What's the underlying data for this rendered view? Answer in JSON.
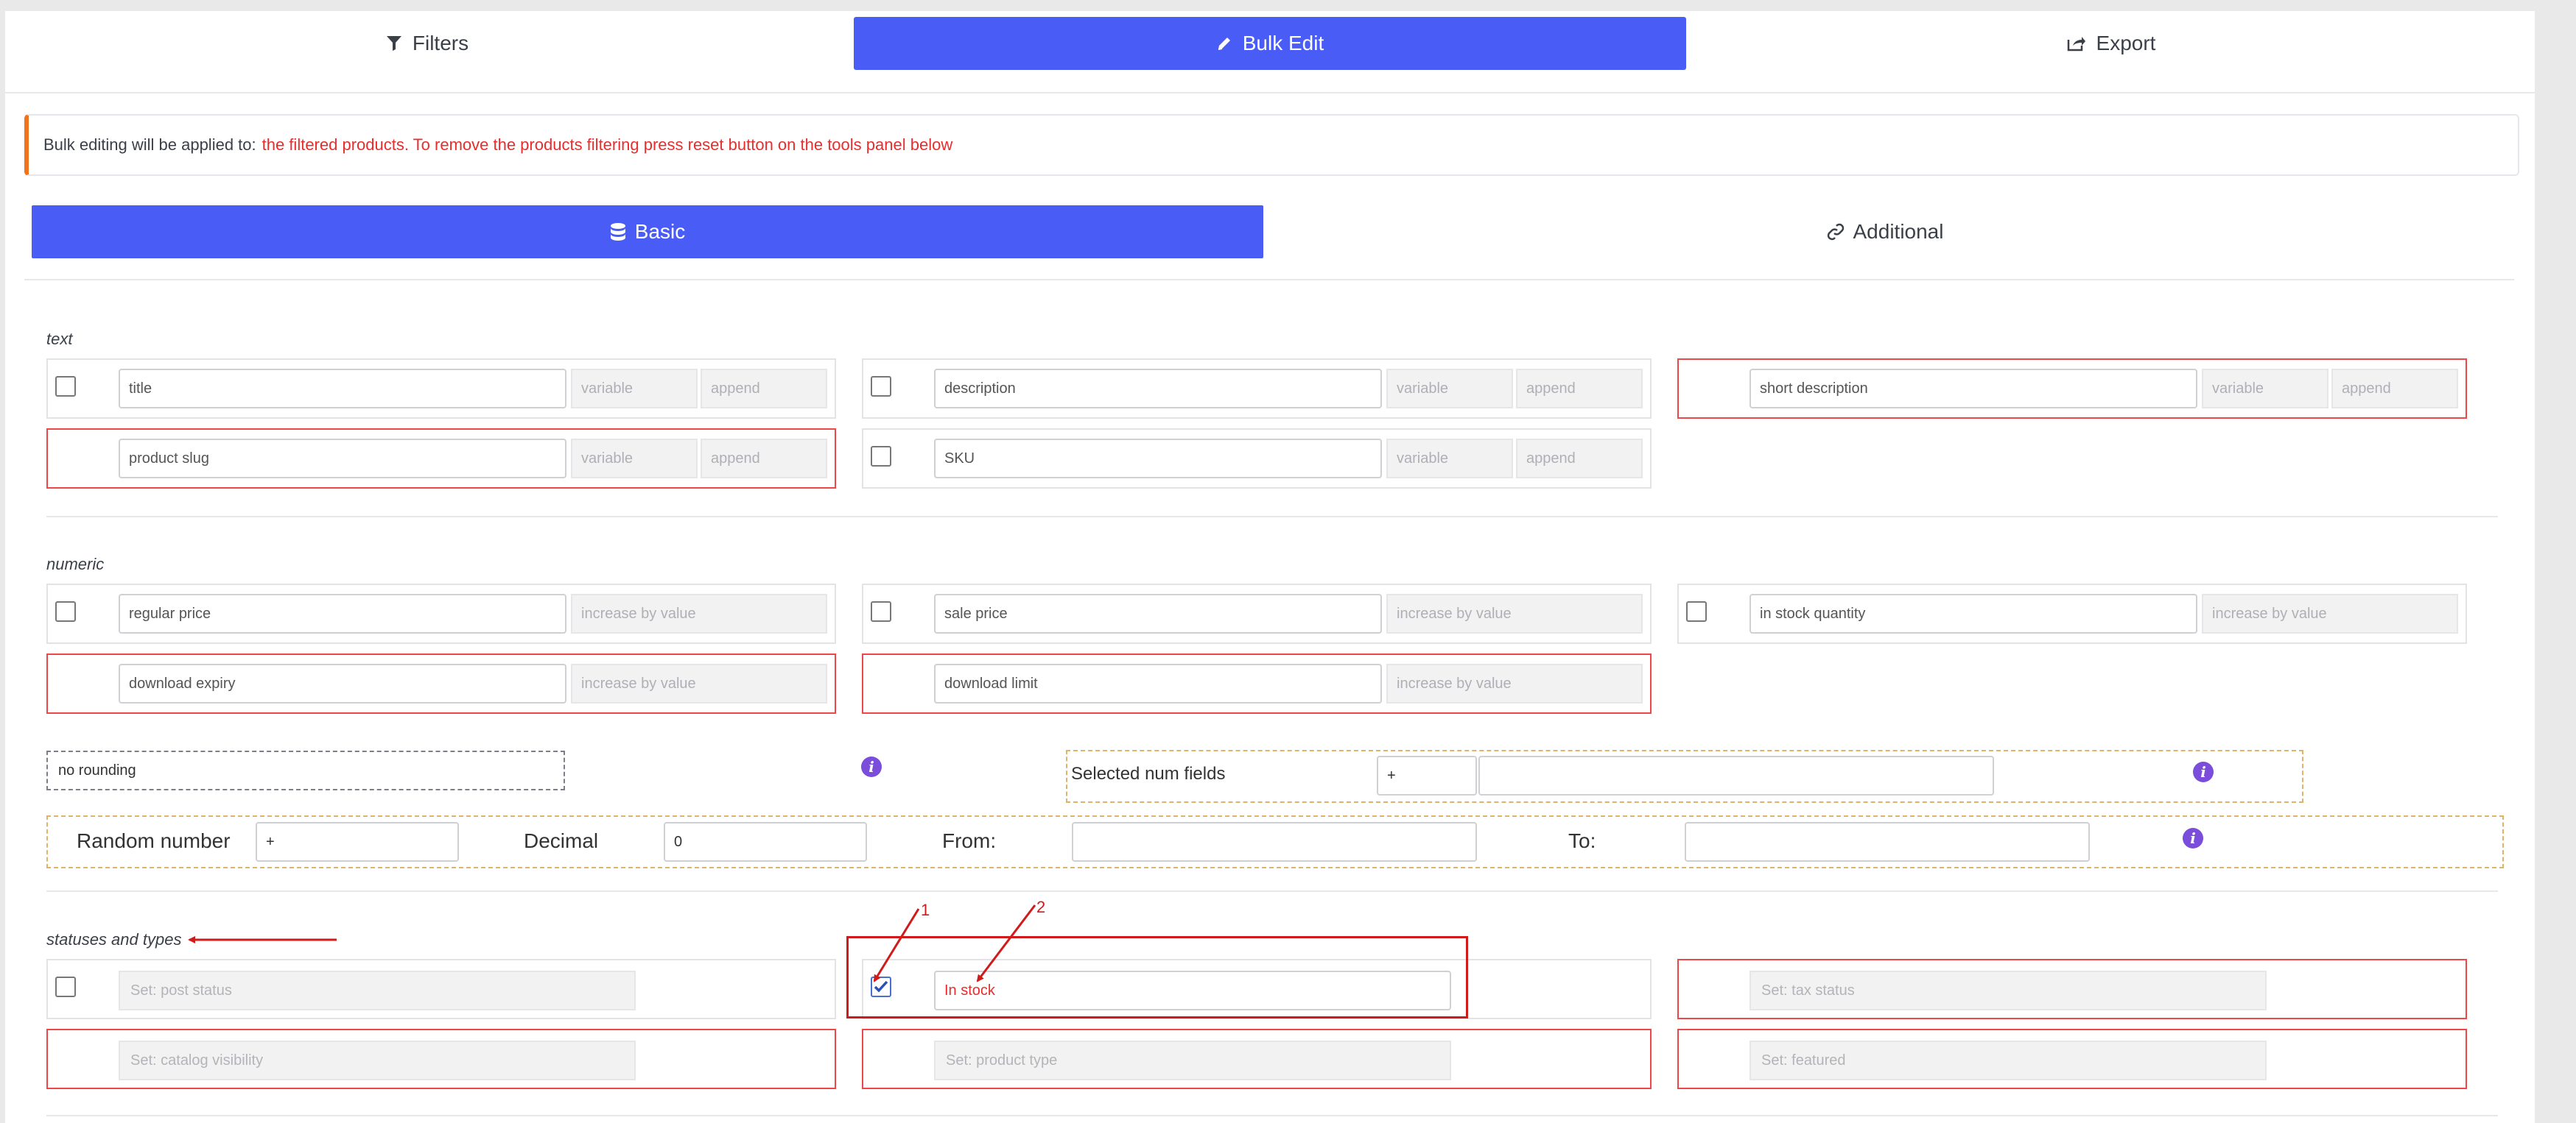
{
  "tabs": {
    "filters": "Filters",
    "bulk_edit": "Bulk Edit",
    "export": "Export"
  },
  "notice": {
    "prefix": "Bulk editing will be applied to:",
    "highlight": "the filtered products. To remove the products filtering press reset button on the tools panel below"
  },
  "subtabs": {
    "basic": "Basic",
    "additional": "Additional"
  },
  "sections": {
    "text": "text",
    "numeric": "numeric",
    "statuses": "statuses and types"
  },
  "text_fields": [
    {
      "label": "title",
      "s1": "variable",
      "s2": "append"
    },
    {
      "label": "description",
      "s1": "variable",
      "s2": "append"
    },
    {
      "label": "short description",
      "s1": "variable",
      "s2": "append"
    },
    {
      "label": "product slug",
      "s1": "variable",
      "s2": "append"
    },
    {
      "label": "SKU",
      "s1": "variable",
      "s2": "append"
    }
  ],
  "numeric_fields": [
    {
      "label": "regular price",
      "action": "increase by value"
    },
    {
      "label": "sale price",
      "action": "increase by value"
    },
    {
      "label": "in stock quantity",
      "action": "increase by value"
    },
    {
      "label": "download expiry",
      "action": "increase by value"
    },
    {
      "label": "download limit",
      "action": "increase by value"
    }
  ],
  "rounding": "no rounding",
  "selected_num": {
    "label": "Selected num fields",
    "operator": "+",
    "value": ""
  },
  "random": {
    "label": "Random number",
    "operator": "+",
    "decimal_label": "Decimal",
    "decimal_value": "0",
    "from_label": "From:",
    "from_value": "",
    "to_label": "To:",
    "to_value": ""
  },
  "status_fields": {
    "post_status": "Set: post status",
    "stock_status": "In stock",
    "tax_status": "Set: tax status",
    "catalog_visibility": "Set: catalog visibility",
    "product_type": "Set: product type",
    "featured": "Set: featured"
  },
  "annotations": {
    "one": "1",
    "two": "2"
  },
  "colors": {
    "accent": "#4a5cf6",
    "warning_border": "#f0731e",
    "highlight_text": "#e62e2e",
    "annotation": "#d01b1b",
    "info_icon": "#7b4ddb"
  },
  "icons": {
    "filters": "filter-icon",
    "bulk_edit": "pencil-icon",
    "export": "export-icon",
    "basic": "database-icon",
    "additional": "link-icon",
    "info": "info-icon"
  }
}
